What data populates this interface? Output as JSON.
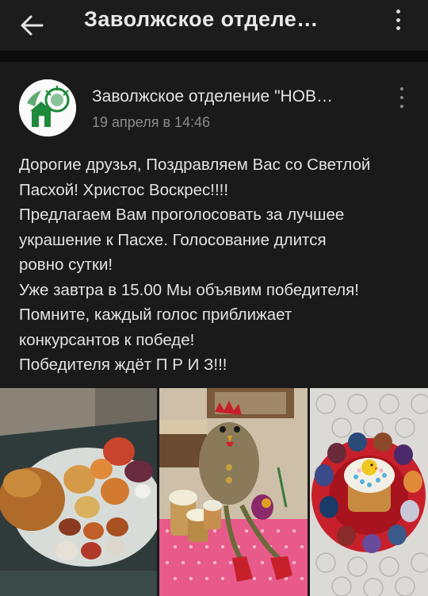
{
  "header": {
    "title": "Заволжское отделе…",
    "back_icon": "arrow-left-icon",
    "menu_icon": "more-vertical-icon"
  },
  "post": {
    "author": "Заволжское отделение \"НОВ…",
    "date": "19 апреля в 14:46",
    "menu_icon": "more-vertical-icon",
    "text_lines": [
      "Дорогие друзья, Поздравляем Вас со Светлой",
      "Пасхой! Христос Воскрес!!!!",
      "Предлагаем Вам проголосовать за лучшее",
      "украшение к Пасхе. Голосование длится",
      "ровно сутки!",
      "Уже завтра в 15.00 Мы объявим победителя!",
      "Помните, каждый голос приближает",
      "конкурсантов к победе!",
      "Победителя ждёт П Р И З!!!"
    ]
  },
  "colors": {
    "background": "#141414",
    "card": "#1a1a1a",
    "logo_green": "#1e8a3a"
  }
}
